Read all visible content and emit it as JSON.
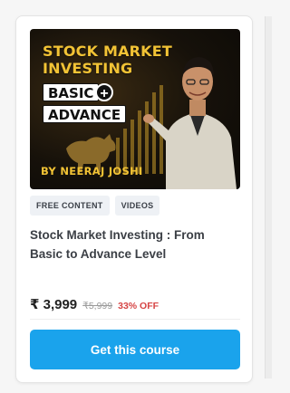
{
  "card": {
    "thumbnail": {
      "title_line1": "STOCK MARKET",
      "title_line2": "INVESTING",
      "pill_basic": "BASIC",
      "pill_plus": "+",
      "pill_advance": "ADVANCE",
      "byline": "BY NEERAJ JOSHI"
    },
    "tags": [
      "FREE CONTENT",
      "VIDEOS"
    ],
    "title": "Stock Market Investing : From Basic to Advance Level",
    "price": "₹ 3,999",
    "mrp": "₹5,999",
    "discount": "33% OFF",
    "cta_label": "Get this course",
    "colors": {
      "accent": "#1aa3ec",
      "thumbnail_gold": "#f2c335",
      "discount_red": "#d64545"
    }
  }
}
